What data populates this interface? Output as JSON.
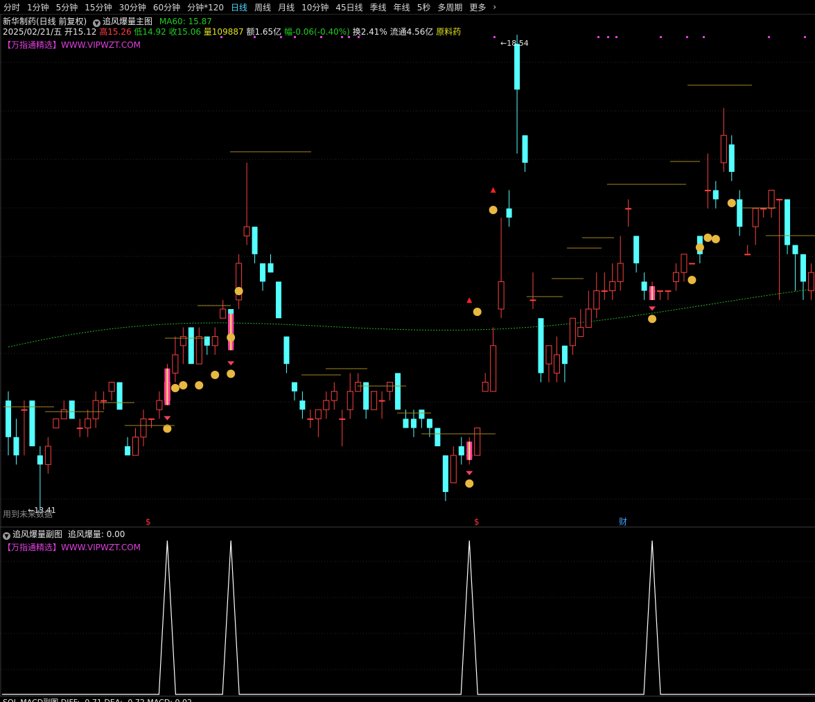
{
  "toolbar": {
    "items": [
      "分时",
      "1分钟",
      "5分钟",
      "15分钟",
      "30分钟",
      "60分钟",
      "分钟*120",
      "日线",
      "周线",
      "月线",
      "10分钟",
      "45日线",
      "季线",
      "年线",
      "5秒",
      "多周期",
      "更多"
    ],
    "active_index": 7
  },
  "header": {
    "stock_name": "新华制药(日线 前复权)",
    "indicator_name": "追风爆量主图",
    "ma_label": "MA60: 15.87",
    "date": "2025/02/21/五",
    "open": "开15.12",
    "high": "高15.26",
    "low": "低14.92",
    "close": "收15.06",
    "volume": "量109887",
    "amount": "额1.65亿",
    "change": "幅-0.06(-0.40%)",
    "turnover": "换2.41%",
    "float": "流通4.56亿",
    "sector": "原料药"
  },
  "main_panel": {
    "brand": "【万指通精选】WWW.VIPWZT.COM",
    "max_label": "18.54",
    "min_label": "13.41",
    "footer_note": "用到未来数据",
    "event_markers": [
      "$",
      "$",
      "财"
    ]
  },
  "sub_panel": {
    "title": "追风爆量副图",
    "value_label": "追风爆量: 0.00",
    "brand": "【万指通精选】WWW.VIPWZT.COM"
  },
  "bottom_panel": {
    "title": "MACD副图",
    "partial_text": "SOL MACD副图 DIFF: -0.71 DEA: -0.72 MACD: 0.02"
  },
  "colors": {
    "up": "#ff4040",
    "down": "#54ffff",
    "ma60": "#22bb22",
    "magenta": "#e040e0",
    "signal_bar": "#ff40a0",
    "sub_line": "#ffffff"
  },
  "chart_data": {
    "type": "candlestick",
    "price_range": [
      13.41,
      18.54
    ],
    "candles": [
      [
        14.6,
        14.2,
        14.7,
        14.0
      ],
      [
        14.2,
        14.0,
        14.4,
        13.9
      ],
      [
        14.5,
        14.5,
        14.6,
        14.0
      ],
      [
        14.6,
        14.1,
        14.6,
        14.1
      ],
      [
        14.0,
        13.9,
        14.1,
        13.4
      ],
      [
        13.9,
        14.1,
        14.2,
        13.8
      ],
      [
        14.3,
        14.4,
        14.4,
        14.3
      ],
      [
        14.4,
        14.5,
        14.6,
        14.4
      ],
      [
        14.6,
        14.4,
        14.6,
        14.4
      ],
      [
        14.3,
        14.3,
        14.4,
        14.2
      ],
      [
        14.3,
        14.4,
        14.5,
        14.2
      ],
      [
        14.4,
        14.6,
        14.7,
        14.3
      ],
      [
        14.6,
        14.6,
        14.7,
        14.5
      ],
      [
        14.7,
        14.8,
        14.8,
        14.6
      ],
      [
        14.8,
        14.5,
        14.8,
        14.5
      ],
      [
        14.1,
        14.0,
        14.2,
        14.0
      ],
      [
        14.0,
        14.2,
        14.3,
        14.0
      ],
      [
        14.2,
        14.4,
        14.5,
        14.1
      ],
      [
        14.4,
        14.4,
        14.4,
        14.3
      ],
      [
        14.5,
        14.6,
        14.7,
        14.4
      ],
      [
        14.6,
        14.8,
        15.0,
        14.6
      ],
      [
        14.9,
        15.1,
        15.3,
        14.8
      ],
      [
        15.2,
        15.3,
        15.4,
        15.0
      ],
      [
        15.4,
        15.0,
        15.4,
        15.0
      ],
      [
        15.0,
        15.3,
        15.4,
        15.0
      ],
      [
        15.3,
        15.2,
        15.3,
        15.1
      ],
      [
        15.2,
        15.3,
        15.4,
        15.1
      ],
      [
        15.5,
        15.6,
        15.7,
        15.5
      ],
      [
        15.6,
        15.2,
        15.6,
        15.2
      ],
      [
        15.7,
        16.1,
        16.2,
        15.6
      ],
      [
        16.4,
        16.5,
        17.2,
        16.3
      ],
      [
        16.5,
        16.2,
        16.5,
        16.1
      ],
      [
        16.1,
        15.9,
        16.1,
        15.8
      ],
      [
        16.1,
        16.0,
        16.2,
        16.0
      ],
      [
        15.9,
        15.5,
        15.9,
        15.5
      ],
      [
        15.3,
        15.0,
        15.3,
        14.9
      ],
      [
        14.8,
        14.7,
        14.8,
        14.6
      ],
      [
        14.6,
        14.5,
        14.7,
        14.4
      ],
      [
        14.4,
        14.4,
        14.5,
        14.3
      ],
      [
        14.4,
        14.5,
        14.5,
        14.2
      ],
      [
        14.5,
        14.6,
        14.7,
        14.4
      ],
      [
        14.6,
        14.7,
        14.8,
        14.5
      ],
      [
        14.4,
        14.4,
        14.5,
        14.1
      ],
      [
        14.5,
        14.7,
        14.9,
        14.4
      ],
      [
        14.7,
        14.8,
        14.9,
        14.7
      ],
      [
        14.8,
        14.5,
        14.8,
        14.4
      ],
      [
        14.5,
        14.7,
        14.7,
        14.5
      ],
      [
        14.6,
        14.6,
        14.7,
        14.4
      ],
      [
        14.7,
        14.8,
        14.8,
        14.6
      ],
      [
        14.9,
        14.5,
        14.9,
        14.5
      ],
      [
        14.4,
        14.3,
        14.5,
        14.3
      ],
      [
        14.4,
        14.3,
        14.5,
        14.2
      ],
      [
        14.5,
        14.4,
        14.5,
        14.3
      ],
      [
        14.4,
        14.3,
        14.4,
        14.2
      ],
      [
        14.3,
        14.1,
        14.3,
        14.1
      ],
      [
        14.0,
        13.6,
        14.0,
        13.5
      ],
      [
        13.7,
        14.0,
        14.1,
        13.7
      ],
      [
        14.1,
        14.0,
        14.2,
        13.9
      ],
      [
        14.0,
        14.0,
        14.2,
        13.9
      ],
      [
        14.0,
        14.3,
        14.3,
        14.0
      ],
      [
        14.7,
        14.8,
        14.9,
        14.7
      ],
      [
        14.7,
        15.2,
        15.4,
        14.7
      ],
      [
        15.6,
        15.9,
        16.6,
        15.5
      ],
      [
        16.7,
        16.6,
        16.9,
        16.5
      ],
      [
        18.5,
        18.0,
        18.6,
        17.3
      ],
      [
        17.5,
        17.2,
        17.5,
        17.1
      ],
      [
        15.7,
        15.7,
        16.0,
        15.6
      ],
      [
        15.5,
        14.9,
        15.5,
        14.8
      ],
      [
        15.0,
        15.2,
        15.2,
        14.8
      ],
      [
        14.9,
        15.1,
        15.3,
        14.8
      ],
      [
        15.2,
        15.0,
        15.2,
        14.8
      ],
      [
        15.2,
        15.5,
        15.5,
        15.1
      ],
      [
        15.3,
        15.4,
        15.6,
        15.3
      ],
      [
        15.4,
        15.6,
        15.8,
        15.4
      ],
      [
        15.6,
        15.8,
        16.0,
        15.5
      ],
      [
        15.8,
        15.8,
        16.0,
        15.7
      ],
      [
        15.8,
        15.9,
        16.1,
        15.7
      ],
      [
        15.9,
        16.1,
        16.4,
        15.8
      ],
      [
        16.7,
        16.7,
        16.8,
        16.5
      ],
      [
        16.4,
        16.1,
        16.4,
        16.0
      ],
      [
        15.9,
        15.8,
        16.0,
        15.7
      ],
      [
        15.8,
        15.8,
        15.9,
        15.7
      ],
      [
        15.8,
        15.8,
        15.8,
        15.7
      ],
      [
        15.8,
        15.8,
        15.8,
        15.7
      ],
      [
        15.9,
        16.0,
        16.1,
        15.8
      ],
      [
        16.0,
        16.2,
        16.2,
        15.9
      ],
      [
        16.1,
        16.1,
        16.1,
        16.1
      ],
      [
        16.4,
        16.2,
        16.4,
        16.1
      ],
      [
        16.9,
        16.9,
        17.3,
        16.7
      ],
      [
        16.9,
        16.8,
        17.0,
        16.7
      ],
      [
        17.2,
        17.5,
        17.8,
        17.1
      ],
      [
        17.4,
        17.1,
        17.5,
        17.0
      ],
      [
        16.8,
        16.5,
        16.9,
        16.4
      ],
      [
        16.2,
        16.2,
        16.3,
        16.2
      ],
      [
        16.5,
        16.7,
        16.7,
        16.3
      ],
      [
        16.7,
        16.7,
        16.7,
        16.6
      ],
      [
        16.7,
        16.9,
        16.9,
        16.6
      ],
      [
        16.8,
        16.8,
        16.8,
        15.7
      ],
      [
        16.8,
        16.3,
        16.8,
        16.2
      ],
      [
        16.3,
        16.2,
        16.3,
        15.8
      ],
      [
        16.2,
        15.9,
        16.2,
        15.7
      ],
      [
        15.8,
        16.0,
        16.1,
        15.7
      ],
      [
        16.0,
        16.0,
        16.0,
        15.8
      ],
      [
        16.0,
        16.1,
        16.1,
        15.9
      ],
      [
        16.1,
        16.2,
        16.3,
        15.9
      ],
      [
        16.2,
        16.4,
        16.5,
        16.1
      ],
      [
        16.4,
        16.3,
        16.4,
        16.2
      ]
    ],
    "ma60_start": 15.2,
    "ma60_end": 15.87,
    "signal_bars": [
      20,
      28,
      58,
      81
    ],
    "sub_spikes": [
      20,
      28,
      58,
      81
    ]
  }
}
